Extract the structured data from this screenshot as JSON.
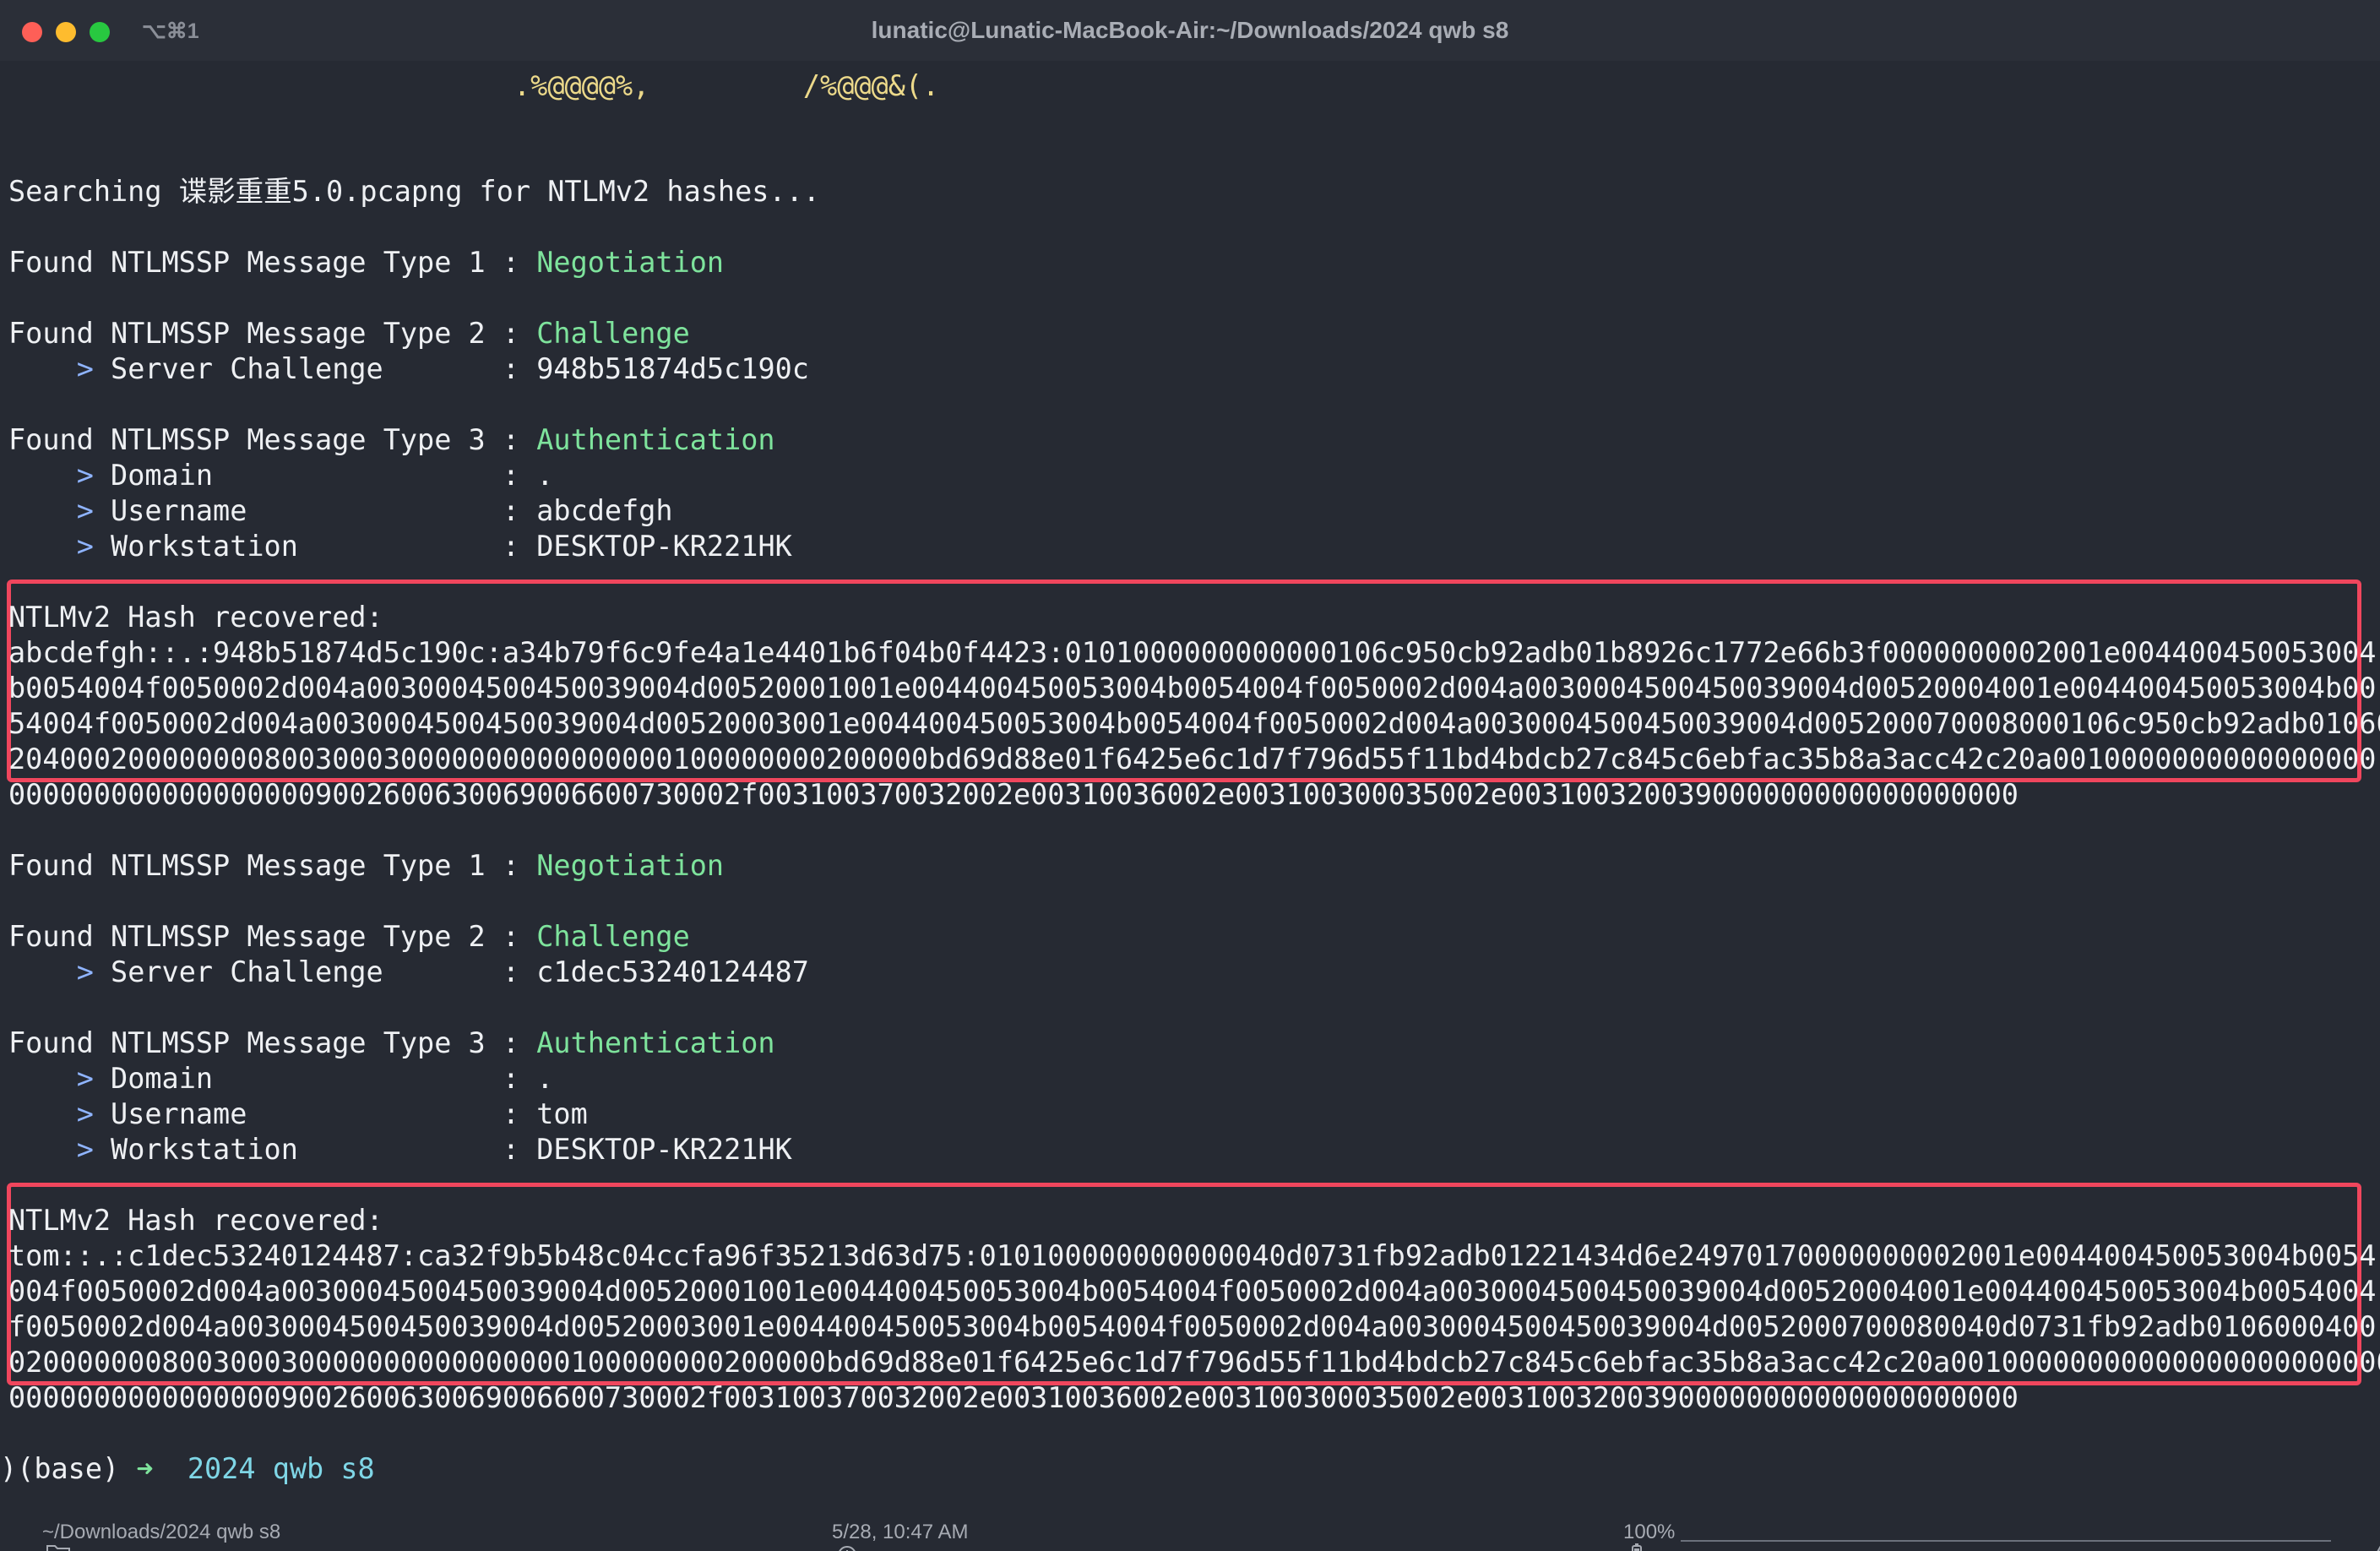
{
  "window": {
    "title": "lunatic@Lunatic-MacBook-Air:~/Downloads/2024 qwb s8",
    "tab_shortcut": "⌥⌘1"
  },
  "terminal": {
    "ascii_art": ".%@@@@%,         /%@@@&(.",
    "search_line": "Searching 谍影重重5.0.pcapng for NTLMv2 hashes...",
    "block1": {
      "t1_prefix": "Found NTLMSSP Message Type 1 : ",
      "t1_value": "Negotiation",
      "t2_prefix": "Found NTLMSSP Message Type 2 : ",
      "t2_value": "Challenge",
      "server_challenge_label": "Server Challenge       : ",
      "server_challenge_value": "948b51874d5c190c",
      "t3_prefix": "Found NTLMSSP Message Type 3 : ",
      "t3_value": "Authentication",
      "domain_label": "Domain                 : ",
      "domain_value": ".",
      "username_label": "Username               : ",
      "username_value": "abcdefgh",
      "workstation_label": "Workstation            : ",
      "workstation_value": "DESKTOP-KR221HK",
      "hash_header": "NTLMv2 Hash recovered:",
      "hash_lines": [
        "abcdefgh::.:948b51874d5c190c:a34b79f6c9fe4a1e4401b6f04b0f4423:0101000000000000106c950cb92adb01b8926c1772e66b3f0000000002001e004400450053004",
        "b0054004f0050002d004a0030004500450039004d00520001001e004400450053004b0054004f0050002d004a0030004500450039004d00520004001e004400450053004b00",
        "54004f0050002d004a0030004500450039004d00520003001e004400450053004b0054004f0050002d004a0030004500450039004d005200070008000106c950cb92adb01060",
        "204000200000000800300030000000000000000100000000200000bd69d88e01f6425e6c1d7f796d55f11bd4bdcb27c845c6ebfac35b8a3acc42c20a0010000000000000000",
        "0000000000000000009002600630069006600730002f003100370032002e00310036002e003100300035002e003100320039000000000000000000"
      ]
    },
    "block2": {
      "t1_prefix": "Found NTLMSSP Message Type 1 : ",
      "t1_value": "Negotiation",
      "t2_prefix": "Found NTLMSSP Message Type 2 : ",
      "t2_value": "Challenge",
      "server_challenge_label": "Server Challenge       : ",
      "server_challenge_value": "c1dec53240124487",
      "t3_prefix": "Found NTLMSSP Message Type 3 : ",
      "t3_value": "Authentication",
      "domain_label": "Domain                 : ",
      "domain_value": ".",
      "username_label": "Username               : ",
      "username_value": "tom",
      "workstation_label": "Workstation            : ",
      "workstation_value": "DESKTOP-KR221HK",
      "hash_header": "NTLMv2 Hash recovered:",
      "hash_lines": [
        "tom::.:c1dec53240124487:ca32f9b5b48c04ccfa96f35213d63d75:010100000000000040d0731fb92adb01221434d6e24970170000000002001e004400450053004b0054",
        "004f0050002d004a0030004500450039004d00520001001e004400450053004b0054004f0050002d004a0030004500450039004d00520004001e004400450053004b0054004",
        "f0050002d004a0030004500450039004d00520003001e004400450053004b0054004f0050002d004a0030004500450039004d0052000700080040d0731fb92adb0106000400",
        "020000000800300030000000000000000100000000200000bd69d88e01f6425e6c1d7f796d55f11bd4bdcb27c845c6ebfac35b8a3acc42c20a00100000000000000000000000",
        "00000000000000009002600630069006600730002f003100370032002e00310036002e003100300035002e00310032003900000000000000000000"
      ]
    },
    "arrow_glyph": ">",
    "prompt": {
      "prefix": ")(base)",
      "arrow": "➜",
      "dir": "2024 qwb s8"
    }
  },
  "statusbar": {
    "folder_icon": "folder-icon",
    "path": "~/Downloads/2024 qwb s8",
    "clock_icon": "clock-icon",
    "datetime": "5/28, 10:47 AM",
    "battery_icon": "battery-icon",
    "battery": "100%",
    "battery_level": 1.0,
    "bolt_icon": "bolt-icon"
  },
  "colors": {
    "background": "#262a33",
    "text": "#eef0f3",
    "green": "#7ee39c",
    "highlight_border": "#f0465d",
    "ascii": "#ecd98a"
  }
}
